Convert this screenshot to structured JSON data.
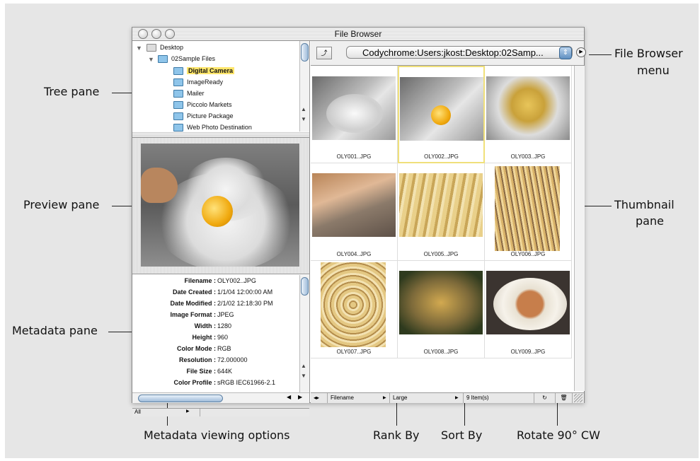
{
  "window": {
    "title": "File Browser"
  },
  "callouts": {
    "tree_pane": "Tree pane",
    "preview_pane": "Preview pane",
    "metadata_pane": "Metadata pane",
    "file_browser_menu_1": "File Browser",
    "file_browser_menu_2": "menu",
    "thumbnail_pane_1": "Thumbnail",
    "thumbnail_pane_2": "pane",
    "metadata_viewing_options": "Metadata viewing options",
    "rank_by": "Rank By",
    "sort_by": "Sort By",
    "rotate": "Rotate 90° CW"
  },
  "tree": {
    "items": [
      {
        "label": "Desktop"
      },
      {
        "label": "02Sample Files"
      },
      {
        "label": "Digital Camera"
      },
      {
        "label": "ImageReady"
      },
      {
        "label": "Mailer"
      },
      {
        "label": "Piccolo Markets"
      },
      {
        "label": "Picture Package"
      },
      {
        "label": "Web Photo Destination"
      }
    ]
  },
  "path": {
    "value": "Codychrome:Users:jkost:Desktop:02Samp..."
  },
  "metadata": {
    "rows": [
      {
        "label": "Filename :",
        "value": "OLY002..JPG"
      },
      {
        "label": "Date Created :",
        "value": "1/1/04 12:00:00 AM"
      },
      {
        "label": "Date Modified :",
        "value": "2/1/02 12:18:30 PM"
      },
      {
        "label": "Image Format :",
        "value": "JPEG"
      },
      {
        "label": "Width :",
        "value": "1280"
      },
      {
        "label": "Height :",
        "value": "960"
      },
      {
        "label": "Color Mode :",
        "value": "RGB"
      },
      {
        "label": "Resolution :",
        "value": "72.000000"
      },
      {
        "label": "File Size :",
        "value": "644K"
      },
      {
        "label": "Color Profile :",
        "value": "sRGB IEC61966-2.1"
      }
    ]
  },
  "thumbnails": [
    {
      "name": "OLY001..JPG"
    },
    {
      "name": "OLY002..JPG"
    },
    {
      "name": "OLY003..JPG"
    },
    {
      "name": "OLY004..JPG"
    },
    {
      "name": "OLY005..JPG"
    },
    {
      "name": "OLY006..JPG"
    },
    {
      "name": "OLY007..JPG"
    },
    {
      "name": "OLY008..JPG"
    },
    {
      "name": "OLY009..JPG"
    }
  ],
  "status": {
    "metadata_view": "All",
    "rank_by": "Filename",
    "sort_by": "Large",
    "count": "9 Item(s)"
  }
}
